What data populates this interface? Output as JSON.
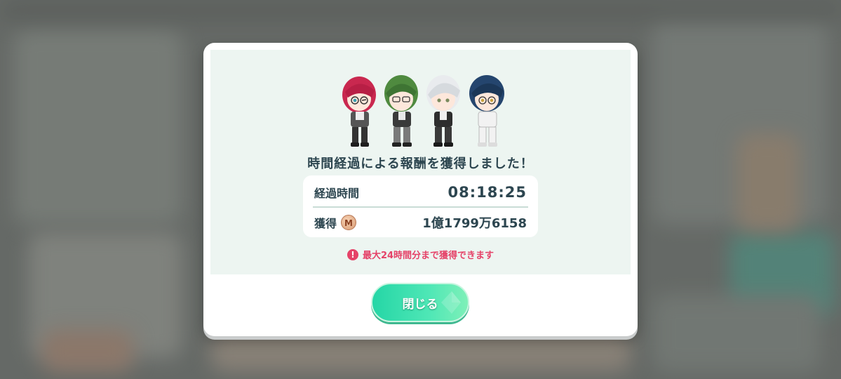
{
  "dialog": {
    "message": "時間経過による報酬を獲得しました！",
    "elapsed_label": "経過時間",
    "elapsed_value": "08:18:25",
    "earned_label": "獲得",
    "coin_letter": "M",
    "earned_value": "1億1799万6158",
    "notice": "最大24時間分まで獲得できます",
    "notice_icon": "!",
    "close_label": "閉じる"
  },
  "colors": {
    "accent_green": "#25d6a6",
    "text_dark": "#2d4650",
    "warning_pink": "#e54268",
    "panel_bg": "#edf5f1"
  },
  "icons": [
    "chibi-characters-illustration",
    "coin-icon",
    "warning-icon"
  ]
}
